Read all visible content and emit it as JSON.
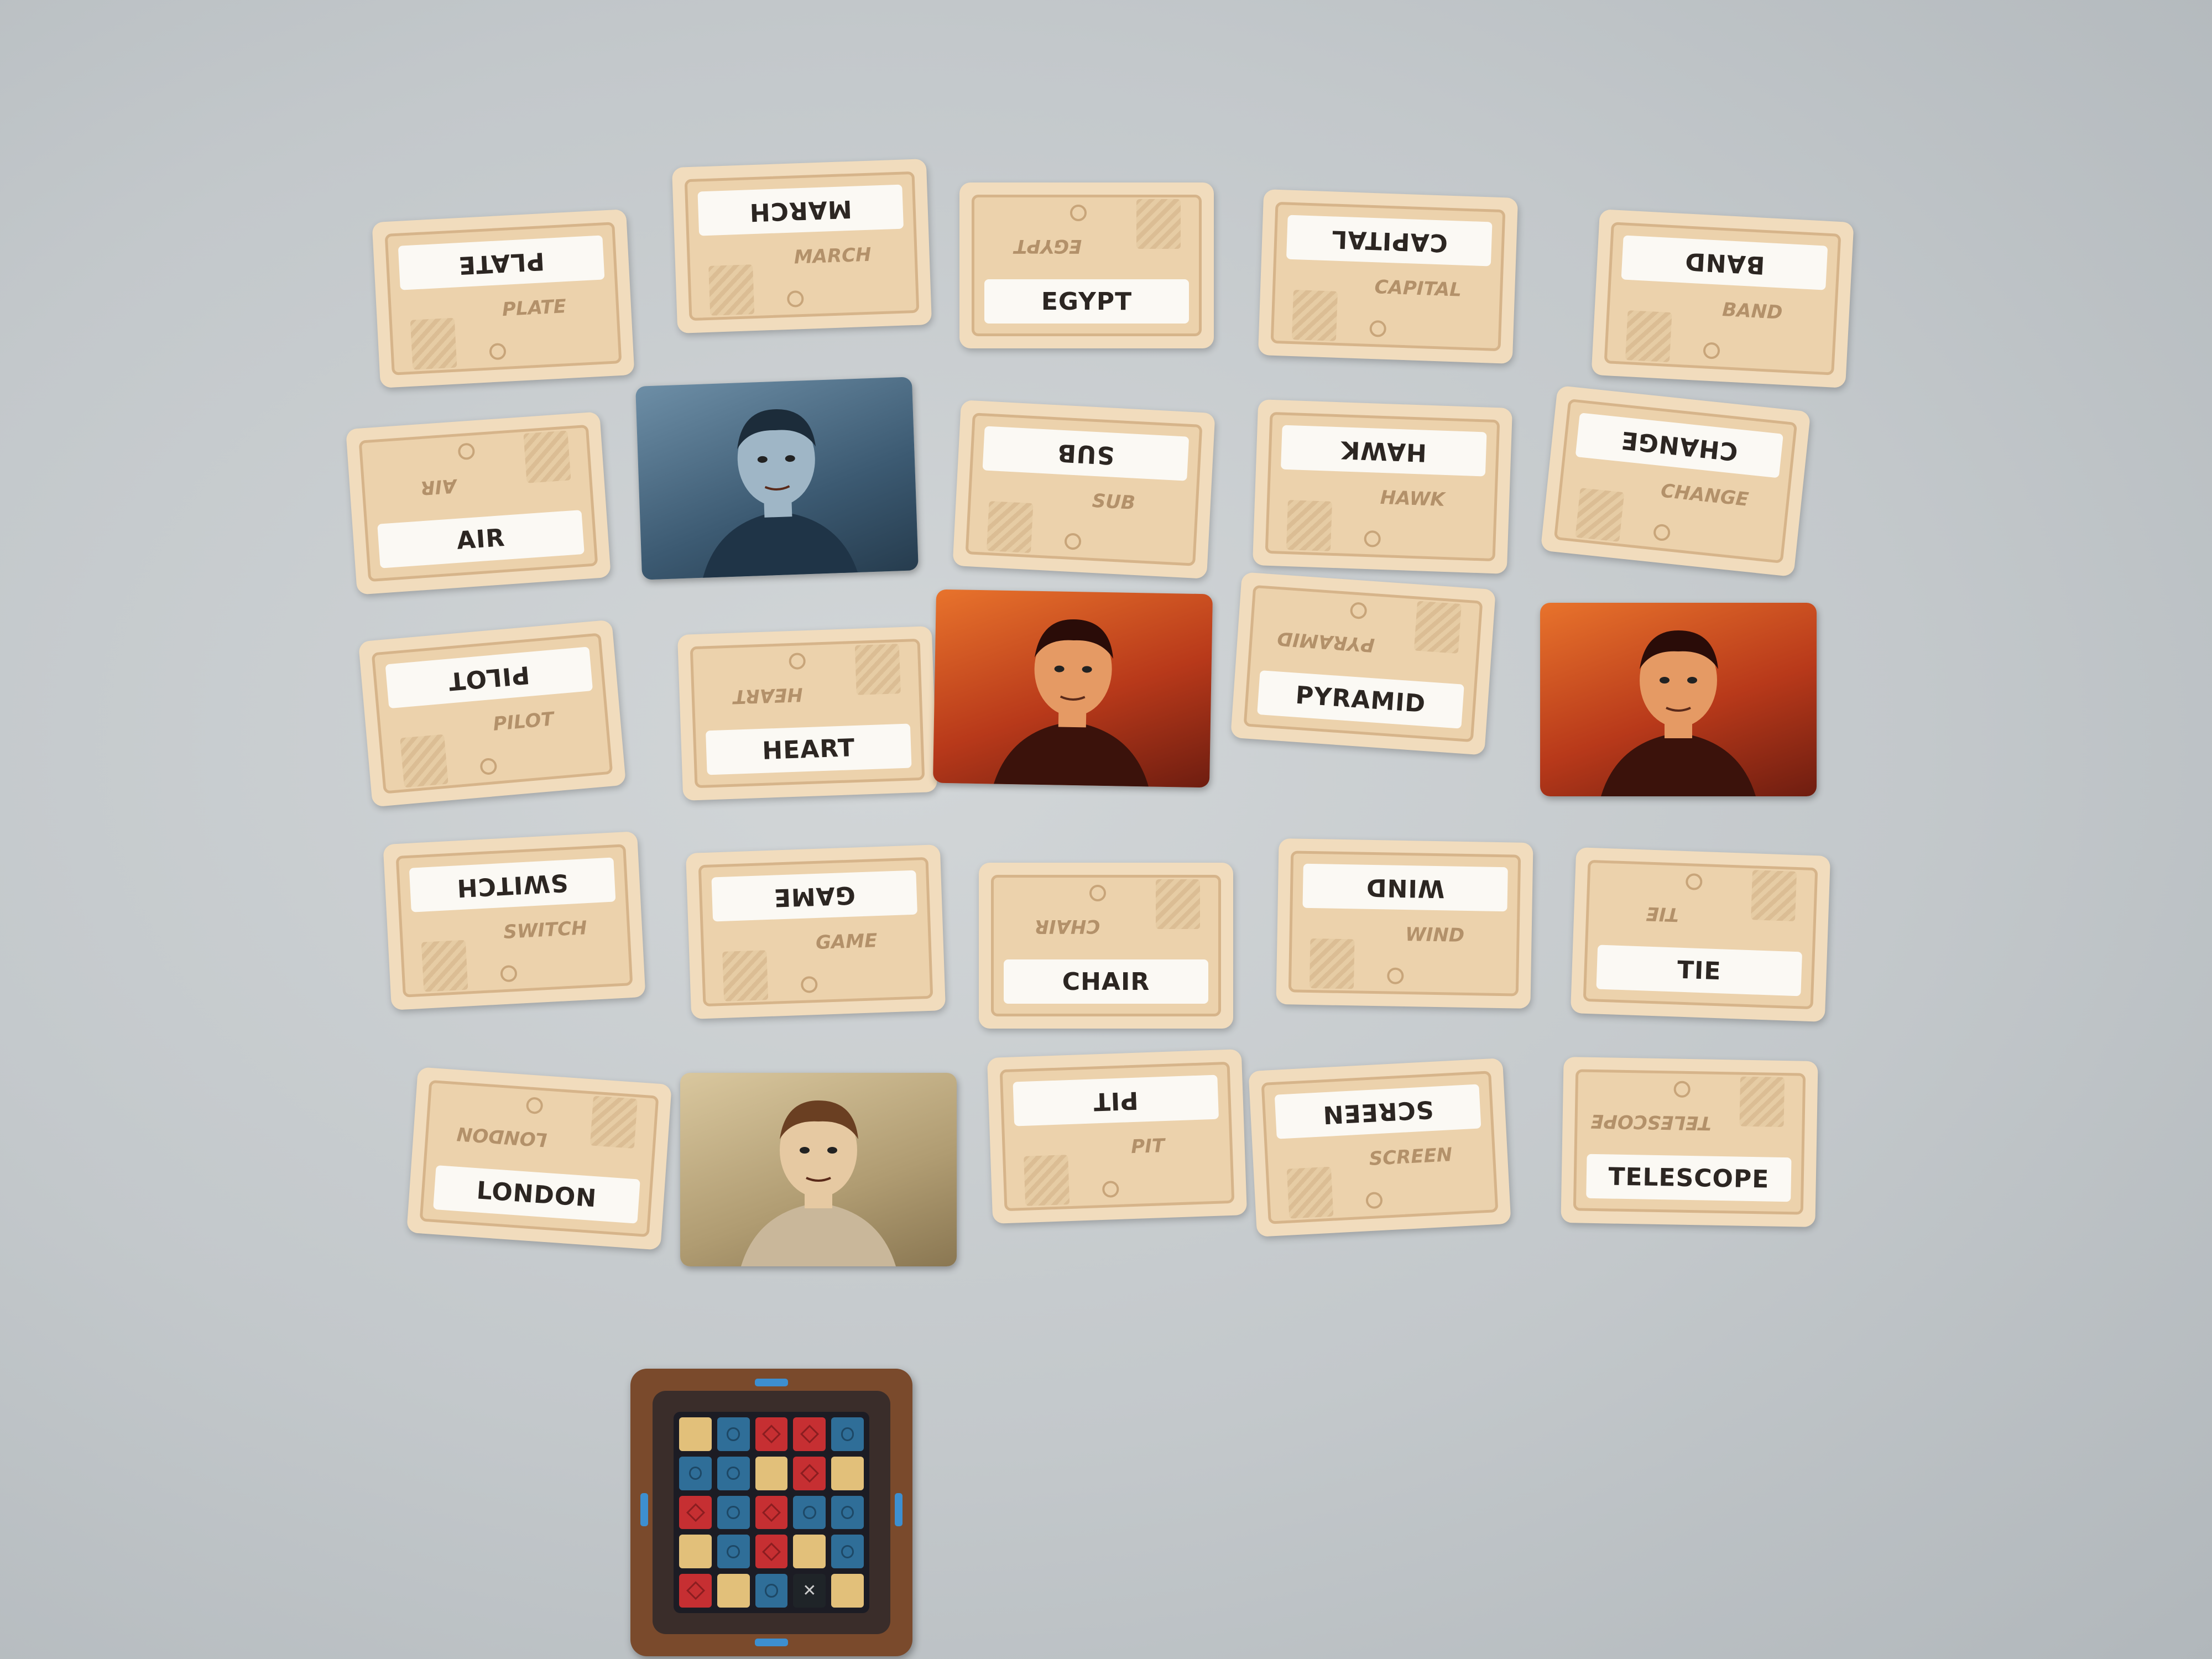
{
  "board": {
    "rows": [
      [
        {
          "word": "PLATE",
          "orient": "top"
        },
        {
          "word": "MARCH",
          "orient": "top"
        },
        {
          "word": "EGYPT",
          "orient": "bottom"
        },
        {
          "word": "CAPITAL",
          "orient": "top"
        },
        {
          "word": "BAND",
          "orient": "top"
        }
      ],
      [
        {
          "word": "AIR",
          "orient": "bottom"
        },
        {
          "agent": "blue"
        },
        {
          "word": "SUB",
          "orient": "top"
        },
        {
          "word": "HAWK",
          "orient": "top"
        },
        {
          "word": "CHANGE",
          "orient": "top"
        }
      ],
      [
        {
          "word": "PILOT",
          "orient": "top"
        },
        {
          "word": "HEART",
          "orient": "bottom"
        },
        {
          "agent": "red"
        },
        {
          "word": "PYRAMID",
          "orient": "bottom"
        },
        {
          "agent": "red"
        }
      ],
      [
        {
          "word": "SWITCH",
          "orient": "top"
        },
        {
          "word": "GAME",
          "orient": "top"
        },
        {
          "word": "CHAIR",
          "orient": "bottom"
        },
        {
          "word": "WIND",
          "orient": "top"
        },
        {
          "word": "TIE",
          "orient": "bottom"
        }
      ],
      [
        {
          "word": "LONDON",
          "orient": "bottom"
        },
        {
          "agent": "neutral"
        },
        {
          "word": "PIT",
          "orient": "top"
        },
        {
          "word": "SCREEN",
          "orient": "top"
        },
        {
          "word": "TELESCOPE",
          "orient": "bottom"
        }
      ]
    ]
  },
  "key_card": {
    "grid": [
      [
        "n",
        "b",
        "r",
        "r",
        "b"
      ],
      [
        "b",
        "b",
        "n",
        "r",
        "n"
      ],
      [
        "r",
        "b",
        "r",
        "b",
        "b"
      ],
      [
        "n",
        "b",
        "r",
        "n",
        "b"
      ],
      [
        "r",
        "n",
        "b",
        "a",
        "n"
      ]
    ]
  },
  "colors": {
    "blue_team": "#2f6e98",
    "red_team": "#c62f32",
    "neutral": "#e2c07a",
    "assassin": "#1f2428",
    "card_tan": "#f1dcbd",
    "table": "#c3c8cb"
  }
}
